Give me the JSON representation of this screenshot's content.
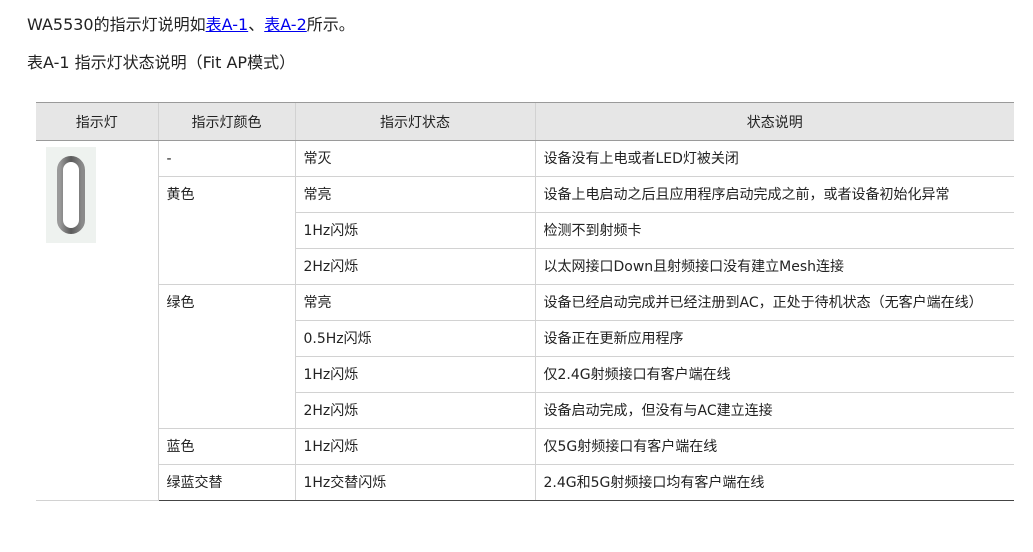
{
  "intro": {
    "prefix": "WA5530的指示灯说明如",
    "link1": "表A-1",
    "sep": "、",
    "link2": "表A-2",
    "suffix": "所示。"
  },
  "caption": "表A-1 指示灯状态说明（Fit AP模式）",
  "table": {
    "headers": [
      "指示灯",
      "指示灯颜色",
      "指示灯状态",
      "状态说明"
    ],
    "indicator_icon": "led-indicator-icon",
    "groups": [
      {
        "color": "-",
        "rows": [
          {
            "state": "常灭",
            "desc": "设备没有上电或者LED灯被关闭"
          }
        ]
      },
      {
        "color": "黄色",
        "rows": [
          {
            "state": "常亮",
            "desc": "设备上电启动之后且应用程序启动完成之前，或者设备初始化异常"
          },
          {
            "state": "1Hz闪烁",
            "desc": "检测不到射频卡"
          },
          {
            "state": "2Hz闪烁",
            "desc": "以太网接口Down且射频接口没有建立Mesh连接"
          }
        ]
      },
      {
        "color": "绿色",
        "rows": [
          {
            "state": "常亮",
            "desc": "设备已经启动完成并已经注册到AC，正处于待机状态（无客户端在线）"
          },
          {
            "state": "0.5Hz闪烁",
            "desc": "设备正在更新应用程序"
          },
          {
            "state": "1Hz闪烁",
            "desc": "仅2.4G射频接口有客户端在线"
          },
          {
            "state": "2Hz闪烁",
            "desc": "设备启动完成，但没有与AC建立连接"
          }
        ]
      },
      {
        "color": "蓝色",
        "rows": [
          {
            "state": "1Hz闪烁",
            "desc": "仅5G射频接口有客户端在线"
          }
        ]
      },
      {
        "color": "绿蓝交替",
        "rows": [
          {
            "state": "1Hz交替闪烁",
            "desc": "2.4G和5G射频接口均有客户端在线"
          }
        ]
      }
    ]
  }
}
